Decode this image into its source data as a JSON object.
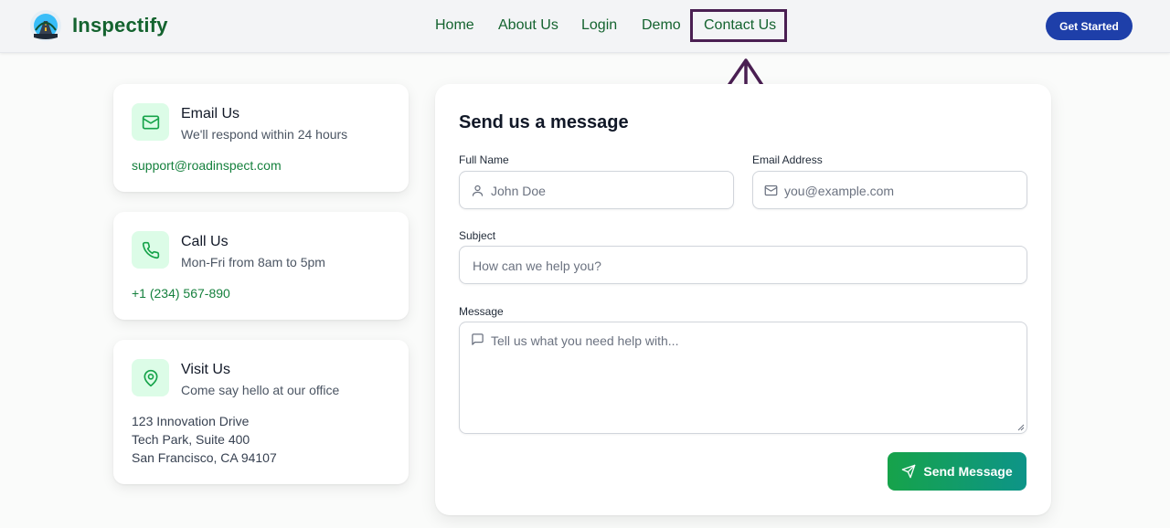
{
  "header": {
    "brand": "Inspectify",
    "nav": [
      {
        "label": "Home"
      },
      {
        "label": "About Us"
      },
      {
        "label": "Login"
      },
      {
        "label": "Demo"
      },
      {
        "label": "Contact Us"
      }
    ],
    "cta_label": "Get Started"
  },
  "contact_cards": [
    {
      "icon": "mail-icon",
      "title": "Email Us",
      "subtitle": "We'll respond within 24 hours",
      "link": "support@roadinspect.com"
    },
    {
      "icon": "phone-icon",
      "title": "Call Us",
      "subtitle": "Mon-Fri from 8am to 5pm",
      "link": "+1 (234) 567-890"
    },
    {
      "icon": "map-pin-icon",
      "title": "Visit Us",
      "subtitle": "Come say hello at our office",
      "address": [
        "123 Innovation Drive",
        "Tech Park, Suite 400",
        "San Francisco, CA 94107"
      ]
    }
  ],
  "form": {
    "title": "Send us a message",
    "full_name": {
      "label": "Full Name",
      "placeholder": "John Doe",
      "value": ""
    },
    "email": {
      "label": "Email Address",
      "placeholder": "you@example.com",
      "value": ""
    },
    "subject": {
      "label": "Subject",
      "placeholder": "How can we help you?",
      "value": ""
    },
    "message": {
      "label": "Message",
      "placeholder": "Tell us what you need help with...",
      "value": ""
    },
    "submit_label": "Send Message"
  },
  "colors": {
    "brand_green": "#14632f",
    "link_green": "#15803d",
    "icon_bg": "#dcfce7",
    "cta_blue": "#1e3fa9",
    "highlight_annotation": "#4a1f52"
  }
}
